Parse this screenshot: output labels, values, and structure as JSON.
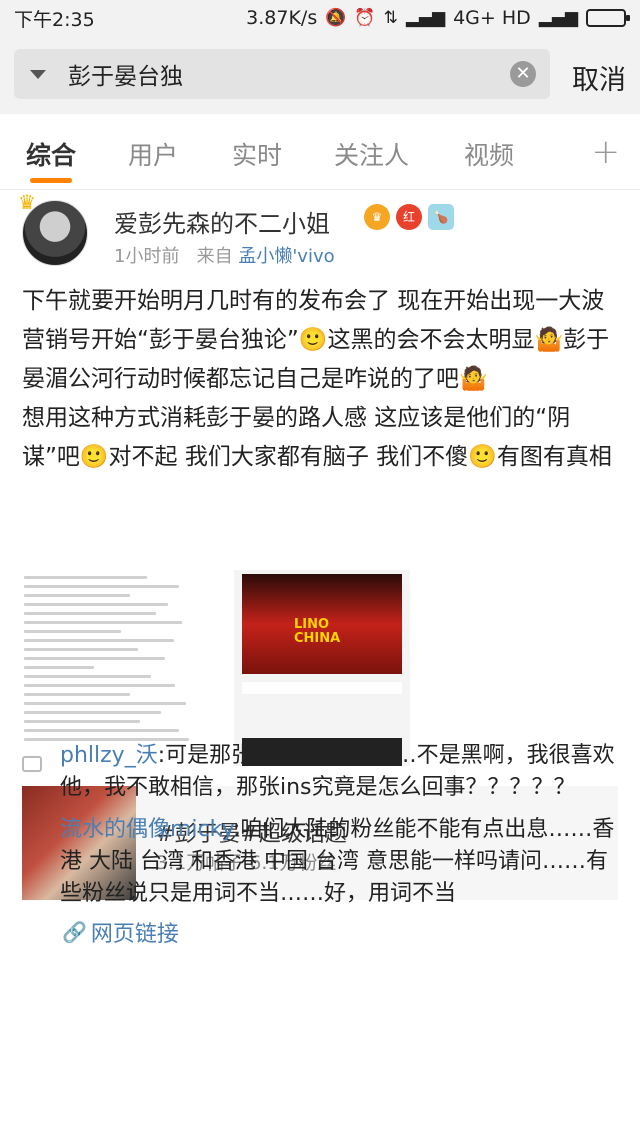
{
  "status_bar": {
    "time": "下午2:35",
    "speed": "3.87K/s",
    "network": "4G+ HD"
  },
  "search": {
    "query": "彭于晏台独",
    "cancel_label": "取消"
  },
  "tabs": [
    {
      "label": "综合"
    },
    {
      "label": "用户"
    },
    {
      "label": "实时"
    },
    {
      "label": "关注人"
    },
    {
      "label": "视频"
    }
  ],
  "post": {
    "username": "爱彭先森的不二小姐",
    "badge_red": "红",
    "time_ago": "1小时前",
    "from_label": "来自",
    "source": "孟小懒'vivo",
    "text": "下午就要开始明月几时有的发布会了 现在开始出现一大波营销号开始“彭于晏台独论”🙂这黑的会不会太明显🤷彭于晏湄公河行动时候都忘记自己是咋说的了吧🤷\n想用这种方式消耗彭于晏的路人感 这应该是他们的“阴谋”吧🙂对不起 我们大家都有脑子 我们不傻🙂有图有真相",
    "image2_text_line1": "LINO",
    "image2_text_line2": "CHINA"
  },
  "topic": {
    "title": "#彭于晏#超级话题",
    "stats": "3.1万帖子 6.1万粉丝"
  },
  "comments": [
    {
      "name": "phllzy_沃",
      "text": ":可是那张ins是真的啊……不是黑啊，我很喜欢他，我不敢相信，那张ins究竟是怎么回事？？？？？"
    },
    {
      "name": "流水的偶像micky",
      "text": ":咱们大陆的粉丝能不能有点出息……香港 大陆  台湾 和香港  中国  台湾  意思能一样吗请问……有些粉丝说只是用词不当……好，用词不当"
    }
  ],
  "link_label": "网页链接"
}
